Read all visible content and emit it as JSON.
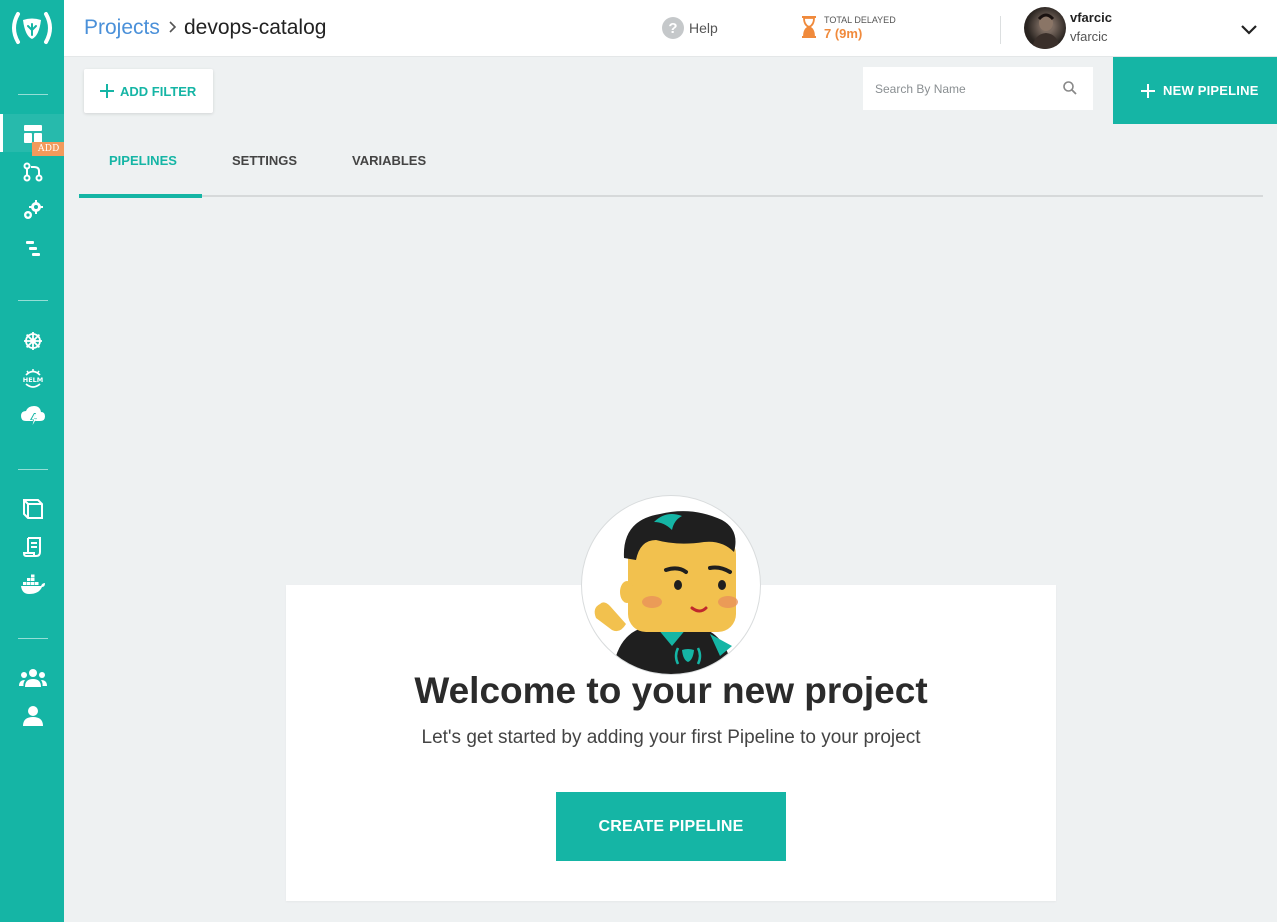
{
  "brand": {
    "accent": "#15b5a5",
    "warning": "#f08a3c",
    "link": "#4a90d9"
  },
  "sidebar": {
    "items": [
      {
        "name": "pipelines-dashboard",
        "icon": "dashboard-icon",
        "active": true
      },
      {
        "name": "builds",
        "icon": "git-branch-icon",
        "badge": "ADD"
      },
      {
        "name": "settings",
        "icon": "gears-icon"
      },
      {
        "name": "steps",
        "icon": "list-steps-icon"
      },
      {
        "name": "kubernetes",
        "icon": "kubernetes-helm-wheel-icon"
      },
      {
        "name": "helm",
        "icon": "helm-icon"
      },
      {
        "name": "environments",
        "icon": "cloud-lightning-icon"
      },
      {
        "name": "catalog",
        "icon": "book-icon"
      },
      {
        "name": "releases",
        "icon": "scroll-icon"
      },
      {
        "name": "docker-images",
        "icon": "docker-icon"
      },
      {
        "name": "teams",
        "icon": "users-icon"
      },
      {
        "name": "user",
        "icon": "user-icon"
      }
    ]
  },
  "header": {
    "breadcrumb_root": "Projects",
    "breadcrumb_current": "devops-catalog",
    "help_label": "Help",
    "delayed_label": "TOTAL DELAYED",
    "delayed_value": "7 (9m)",
    "user_name": "vfarcic",
    "user_account": "vfarcic"
  },
  "toolbar": {
    "add_filter_label": "ADD FILTER",
    "search_placeholder": "Search By Name",
    "new_pipeline_label": "NEW PIPELINE"
  },
  "tabs": [
    {
      "label": "PIPELINES",
      "active": true
    },
    {
      "label": "SETTINGS",
      "active": false
    },
    {
      "label": "VARIABLES",
      "active": false
    }
  ],
  "welcome": {
    "title": "Welcome to your new project",
    "subtitle": "Let's get started by adding your first Pipeline to your project",
    "cta_label": "CREATE PIPELINE"
  }
}
